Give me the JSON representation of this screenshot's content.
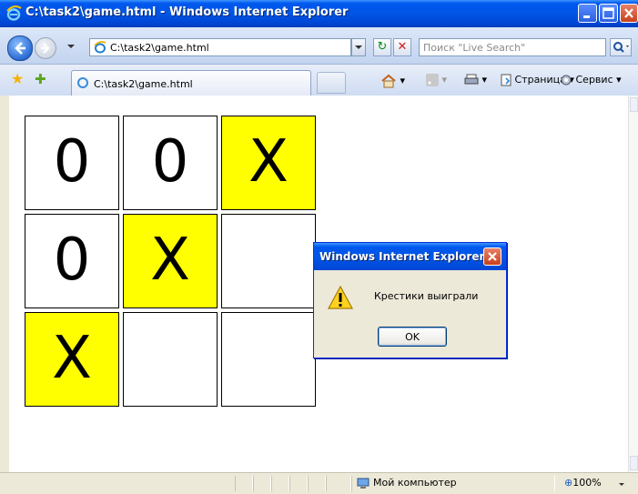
{
  "window": {
    "title": "C:\\task2\\game.html - Windows Internet Explorer"
  },
  "address_bar": {
    "url": "C:\\task2\\game.html"
  },
  "search": {
    "placeholder": "Поиск \"Live Search\""
  },
  "tab": {
    "label": "C:\\task2\\game.html"
  },
  "command_bar": {
    "page_label": "Страница",
    "tools_label": "Сервис"
  },
  "board": {
    "cells": [
      {
        "value": "0",
        "highlight": false
      },
      {
        "value": "0",
        "highlight": false
      },
      {
        "value": "X",
        "highlight": true
      },
      {
        "value": "0",
        "highlight": false
      },
      {
        "value": "X",
        "highlight": true
      },
      {
        "value": "",
        "highlight": false
      },
      {
        "value": "X",
        "highlight": true
      },
      {
        "value": "",
        "highlight": false
      },
      {
        "value": "",
        "highlight": false
      }
    ],
    "highlight_color": "#ffff00"
  },
  "dialog": {
    "title": "Windows Internet Explorer",
    "message": "Крестики выиграли",
    "ok_label": "OK",
    "icon": "warning-icon"
  },
  "status_bar": {
    "zone": "Мой компьютер",
    "zoom": "100%"
  }
}
